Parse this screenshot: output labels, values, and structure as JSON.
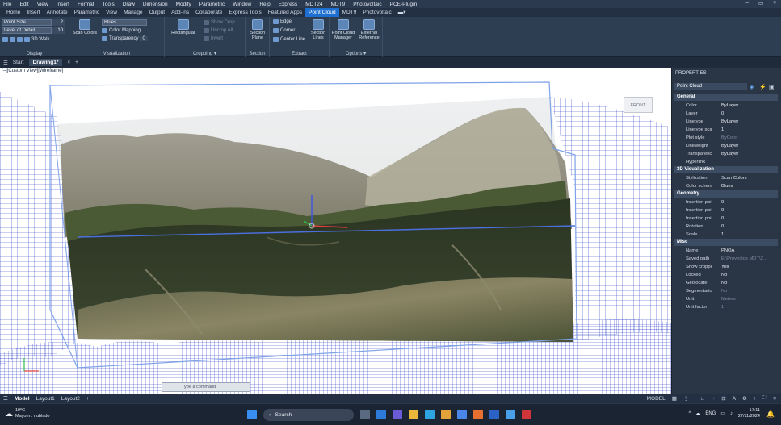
{
  "menubar": {
    "items": [
      "File",
      "Edit",
      "View",
      "Insert",
      "Format",
      "Tools",
      "Draw",
      "Dimension",
      "Modify",
      "Parametric",
      "Window",
      "Help",
      "Express",
      "MDT24",
      "MDT9",
      "Photovoltaic",
      "PCE-Plugin"
    ],
    "window_controls": [
      "–",
      "▭",
      "×"
    ]
  },
  "ribbon_tabs": {
    "items": [
      "Home",
      "Insert",
      "Annotate",
      "Parametric",
      "View",
      "Manage",
      "Output",
      "Add-ins",
      "Collaborate",
      "Express Tools",
      "Featured Apps",
      "Point Cloud",
      "MDT9",
      "Photovoltaic"
    ],
    "active": "Point Cloud"
  },
  "ribbon": {
    "display": {
      "title": "Display",
      "point_size_label": "Point Size",
      "point_size_value": "2",
      "level_of_detail_label": "Level of Detail",
      "level_of_detail_value": "10",
      "walk_label": "3D Walk"
    },
    "visualization": {
      "title": "Visualization",
      "scan_colors_label": "Scan Colors",
      "color_scheme_value": "Blues",
      "color_mapping_label": "Color Mapping",
      "transparency_label": "Transparency",
      "transparency_value": "0"
    },
    "cropping": {
      "title": "Cropping",
      "rectangular_label": "Rectangular",
      "show_crop_label": "Show Crop",
      "uncrop_all_label": "Uncrop All",
      "invert_label": "Invert"
    },
    "section": {
      "title": "Section",
      "section_plane_label": "Section Plane"
    },
    "extract": {
      "title": "Extract",
      "edge_label": "Edge",
      "corner_label": "Corner",
      "center_line_label": "Center Line",
      "section_lines_label": "Section Lines"
    },
    "options": {
      "title": "Options",
      "manager_label": "Point Cloud Manager",
      "external_ref_label": "External Reference"
    }
  },
  "doc_tabs": {
    "start": "Start",
    "drawing": "Drawing1*",
    "close": "×",
    "add": "+"
  },
  "viewport": {
    "label": "[–][Custom View][Wireframe]",
    "viewcube_label": "FRONT",
    "command_placeholder": "Type a command"
  },
  "properties": {
    "title": "PROPERTIES",
    "object_type": "Point Cloud",
    "sections": [
      {
        "name": "General",
        "rows": [
          {
            "k": "Color",
            "v": "ByLayer"
          },
          {
            "k": "Layer",
            "v": "0"
          },
          {
            "k": "Linetype",
            "v": "ByLayer"
          },
          {
            "k": "Linetype scale",
            "v": "1"
          },
          {
            "k": "Plot style",
            "v": "ByColor",
            "dim": true
          },
          {
            "k": "Lineweight",
            "v": "ByLayer"
          },
          {
            "k": "Transparency",
            "v": "ByLayer"
          },
          {
            "k": "Hyperlink",
            "v": ""
          }
        ]
      },
      {
        "name": "3D Visualization",
        "rows": [
          {
            "k": "Stylization",
            "v": "Scan Colors"
          },
          {
            "k": "Color scheme",
            "v": "Blues"
          }
        ]
      },
      {
        "name": "Geometry",
        "rows": [
          {
            "k": "Insertion point...",
            "v": "0"
          },
          {
            "k": "Insertion point...",
            "v": "0"
          },
          {
            "k": "Insertion point...",
            "v": "0"
          },
          {
            "k": "Rotation",
            "v": "0"
          },
          {
            "k": "Scale",
            "v": "1"
          }
        ]
      },
      {
        "name": "Misc",
        "rows": [
          {
            "k": "Name",
            "v": "PNOA"
          },
          {
            "k": "Saved path",
            "v": "E:\\Proyectos MDT\\2...",
            "dim": true
          },
          {
            "k": "Show cropped",
            "v": "Yes"
          },
          {
            "k": "Locked",
            "v": "No"
          },
          {
            "k": "Geolocate",
            "v": "No"
          },
          {
            "k": "Segmentation",
            "v": "No",
            "dim": true
          },
          {
            "k": "Unit",
            "v": "Meters",
            "dim": true
          },
          {
            "k": "Unit factor",
            "v": "1",
            "dim": true
          }
        ]
      }
    ]
  },
  "statusbar": {
    "model_tab": "Model",
    "layout1": "Layout1",
    "layout2": "Layout2",
    "add": "+",
    "model_mode": "MODEL"
  },
  "taskbar": {
    "weather_temp": "19ºC",
    "weather_desc": "Mayorm. nublado",
    "search_placeholder": "Search",
    "lang": "ENG",
    "time": "17:11",
    "date": "27/11/2024"
  },
  "colors": {
    "accent": "#1d6fd1",
    "mesh": "#2a3fc8",
    "ribbon_bg": "#2d3d52"
  }
}
